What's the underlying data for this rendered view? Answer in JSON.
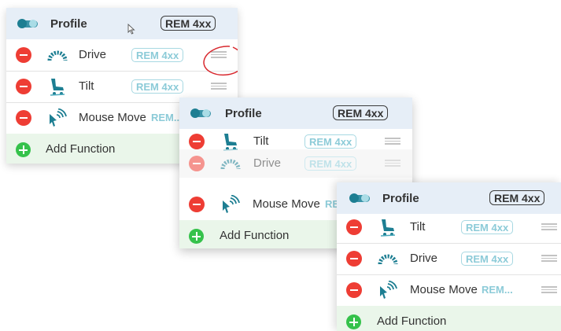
{
  "panel_1": {
    "profile": {
      "title": "Profile",
      "remote": "REM 4xx"
    },
    "functions": [
      {
        "name": "Drive",
        "icon": "drive-gauge-icon",
        "remote": "REM 4xx"
      },
      {
        "name": "Tilt",
        "icon": "tilt-seat-icon",
        "remote": "REM 4xx"
      },
      {
        "name": "Mouse Move",
        "icon": "mouse-move-icon",
        "remote": "REM..."
      }
    ],
    "add_label": "Add Function"
  },
  "panel_2": {
    "profile": {
      "title": "Profile",
      "remote": "REM 4xx"
    },
    "functions": [
      {
        "name": "Tilt",
        "icon": "tilt-seat-icon",
        "remote": "REM 4xx"
      },
      {
        "name": "Drive",
        "icon": "drive-gauge-icon",
        "remote": "REM 4xx",
        "state": "dragging"
      },
      {
        "name": "Mouse Move",
        "icon": "mouse-move-icon",
        "remote": "RE"
      }
    ],
    "add_label": "Add Function"
  },
  "panel_3": {
    "profile": {
      "title": "Profile",
      "remote": "REM 4xx"
    },
    "functions": [
      {
        "name": "Tilt",
        "icon": "tilt-seat-icon",
        "remote": "REM 4xx"
      },
      {
        "name": "Drive",
        "icon": "drive-gauge-icon",
        "remote": "REM 4xx"
      },
      {
        "name": "Mouse Move",
        "icon": "mouse-move-icon",
        "remote": "REM..."
      }
    ],
    "add_label": "Add Function"
  },
  "colors": {
    "header_bg": "#e6eef7",
    "add_row_bg": "#eaf6ea",
    "delete_red": "#ee3d34",
    "add_green": "#35c24b",
    "teal_accent": "#1d7e92",
    "remote_tag": "#8ccbd8",
    "annotation_red": "#d8282e"
  }
}
